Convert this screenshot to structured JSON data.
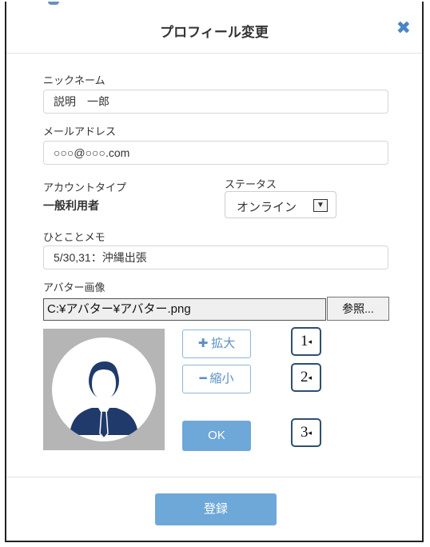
{
  "dialog": {
    "title": "プロフィール変更",
    "close_icon": "close-icon"
  },
  "nickname": {
    "label": "ニックネーム",
    "value": "説明　一郎"
  },
  "email": {
    "label": "メールアドレス",
    "value": "○○○@○○○.com"
  },
  "account_type": {
    "label": "アカウントタイプ",
    "value": "一般利用者"
  },
  "status": {
    "label": "ステータス",
    "selected": "オンライン",
    "arrow_icon": "chevron-down-icon"
  },
  "memo": {
    "label": "ひとことメモ",
    "value": "5/30,31：沖縄出張"
  },
  "avatar": {
    "label": "アバター画像",
    "file_path": "C:¥アバター¥アバター.png",
    "browse_label": "参照...",
    "zoom_in": {
      "symbol": "✚",
      "label": "拡大"
    },
    "zoom_out": {
      "symbol": "━",
      "label": "縮小"
    },
    "ok_label": "OK"
  },
  "callouts": [
    "1",
    "2",
    "3"
  ],
  "footer": {
    "register_label": "登録"
  },
  "colors": {
    "accent": "#6ea8d8",
    "close": "#4a86c5",
    "avatar_bg": "#b5b5b5",
    "person": "#1f3a6b"
  }
}
